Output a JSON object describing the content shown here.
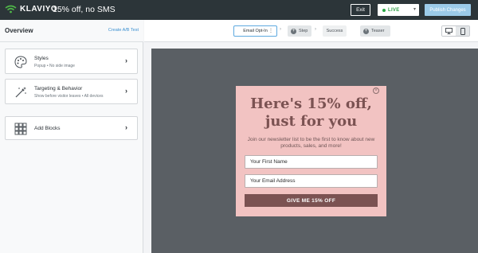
{
  "topbar": {
    "brand": "KLAVIYO",
    "form_title": "15% off, no SMS",
    "exit_label": "Exit",
    "status_label": "LIVE",
    "publish_label": "Publish Changes"
  },
  "left_panel": {
    "title": "Overview",
    "create_ab_label": "Create A/B Test",
    "cards": [
      {
        "title": "Styles",
        "subtitle": "Popup • No side image",
        "icon": "palette-icon"
      },
      {
        "title": "Targeting & Behavior",
        "subtitle": "Show before visitor leaves • All devices",
        "icon": "magic-wand-icon"
      },
      {
        "title": "Add Blocks",
        "subtitle": "",
        "icon": "blocks-grid-icon"
      }
    ]
  },
  "toolbar": {
    "steps": [
      {
        "label": "Email Opt-In"
      },
      {
        "label": "Step"
      },
      {
        "label": "Success"
      },
      {
        "label": "Teaser"
      }
    ],
    "devices": [
      "desktop-icon",
      "mobile-icon"
    ]
  },
  "popup": {
    "headline_line1": "Here's 15% off,",
    "headline_line2": "just for you",
    "subtext": "Join our newsletter list to be the first to know about new products, sales, and more!",
    "first_name_placeholder": "Your First Name",
    "email_placeholder": "Your Email Address",
    "cta_label": "GIVE ME 15% OFF"
  },
  "colors": {
    "topbar": "#2c3539",
    "publish": "#9ccbe9",
    "popup_bg": "#f2c3c2",
    "popup_accent": "#7b5252",
    "preview_bg": "#5a5f64",
    "live_green": "#28a745"
  }
}
